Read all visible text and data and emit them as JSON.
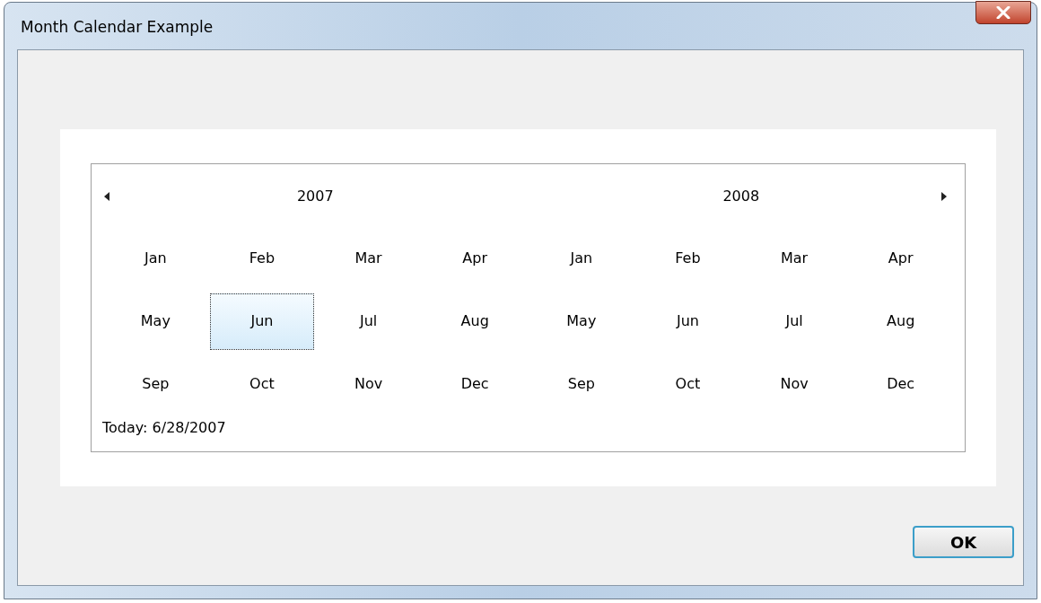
{
  "window": {
    "title": "Month Calendar Example"
  },
  "calendars": [
    {
      "year": "2007",
      "months": [
        {
          "label": "Jan",
          "selected": false
        },
        {
          "label": "Feb",
          "selected": false
        },
        {
          "label": "Mar",
          "selected": false
        },
        {
          "label": "Apr",
          "selected": false
        },
        {
          "label": "May",
          "selected": false
        },
        {
          "label": "Jun",
          "selected": true
        },
        {
          "label": "Jul",
          "selected": false
        },
        {
          "label": "Aug",
          "selected": false
        },
        {
          "label": "Sep",
          "selected": false
        },
        {
          "label": "Oct",
          "selected": false
        },
        {
          "label": "Nov",
          "selected": false
        },
        {
          "label": "Dec",
          "selected": false
        }
      ]
    },
    {
      "year": "2008",
      "months": [
        {
          "label": "Jan",
          "selected": false
        },
        {
          "label": "Feb",
          "selected": false
        },
        {
          "label": "Mar",
          "selected": false
        },
        {
          "label": "Apr",
          "selected": false
        },
        {
          "label": "May",
          "selected": false
        },
        {
          "label": "Jun",
          "selected": false
        },
        {
          "label": "Jul",
          "selected": false
        },
        {
          "label": "Aug",
          "selected": false
        },
        {
          "label": "Sep",
          "selected": false
        },
        {
          "label": "Oct",
          "selected": false
        },
        {
          "label": "Nov",
          "selected": false
        },
        {
          "label": "Dec",
          "selected": false
        }
      ]
    }
  ],
  "today": "Today: 6/28/2007",
  "buttons": [
    {
      "label": "OK"
    }
  ]
}
